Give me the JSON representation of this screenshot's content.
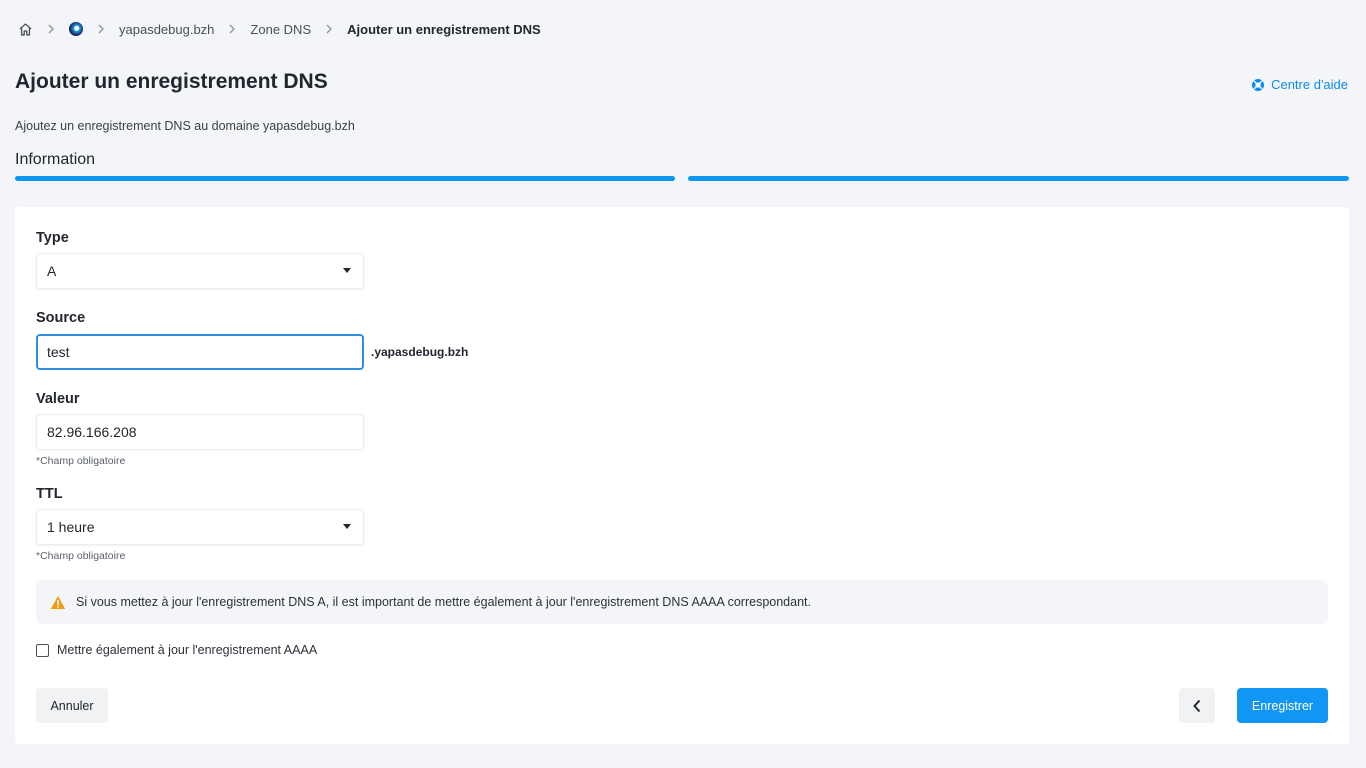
{
  "breadcrumb": {
    "home_icon": "home-icon",
    "brand_icon": "brand-logo-icon",
    "items": [
      "yapasdebug.bzh",
      "Zone DNS",
      "Ajouter un enregistrement DNS"
    ]
  },
  "header": {
    "title": "Ajouter un enregistrement DNS",
    "help_label": "Centre d'aide",
    "subtitle": "Ajoutez un enregistrement DNS au domaine yapasdebug.bzh"
  },
  "steps": {
    "current_label": "Information",
    "progress_color": "#1196ee",
    "total": 2,
    "completed": 2
  },
  "form": {
    "type": {
      "label": "Type",
      "value": "A"
    },
    "source": {
      "label": "Source",
      "value": "test",
      "suffix": ".yapasdebug.bzh"
    },
    "valeur": {
      "label": "Valeur",
      "value": "82.96.166.208",
      "hint": "*Champ obligatoire"
    },
    "ttl": {
      "label": "TTL",
      "value": "1 heure",
      "hint": "*Champ obligatoire"
    }
  },
  "alert": {
    "icon": "warning-icon",
    "color": "#f39c12",
    "text": "Si vous mettez à jour l'enregistrement DNS A, il est important de mettre également à jour l'enregistrement DNS AAAA correspondant."
  },
  "checkbox": {
    "label": "Mettre également à jour l'enregistrement AAAA",
    "checked": false
  },
  "actions": {
    "cancel_label": "Annuler",
    "back_icon": "chevron-left-icon",
    "save_label": "Enregistrer",
    "accent": "#1296f3"
  }
}
